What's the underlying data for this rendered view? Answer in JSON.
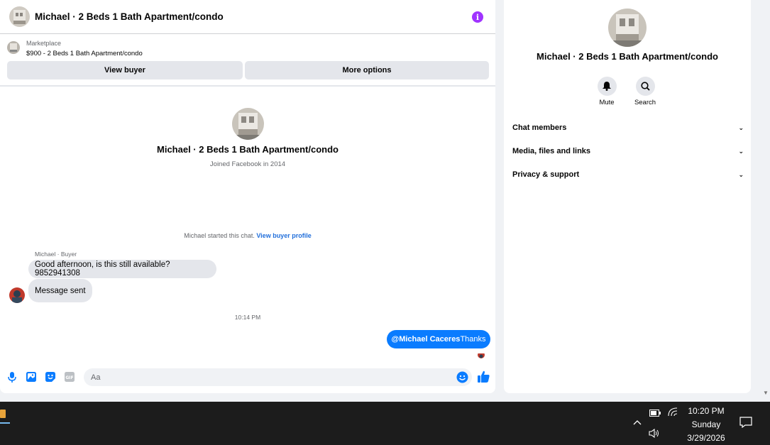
{
  "chat": {
    "title": "Michael · 2 Beds 1 Bath Apartment/condo",
    "info_icon": "info-icon"
  },
  "marketplace": {
    "label": "Marketplace",
    "item": "$900 - 2 Beds 1 Bath Apartment/condo",
    "view_buyer": "View buyer",
    "more_options": "More options"
  },
  "profile": {
    "name": "Michael · 2 Beds 1 Bath Apartment/condo",
    "joined": "Joined Facebook in 2014"
  },
  "thread": {
    "started_text": "Michael started this chat.",
    "started_link": "View buyer profile",
    "sender_label": "Michael · Buyer",
    "messages_in": [
      "Good afternoon, is this still available? 9852941308",
      "Message sent"
    ],
    "timestamp": "10:14 PM",
    "message_out_mention": "@Michael Caceres",
    "message_out_text": "Thanks"
  },
  "composer": {
    "placeholder": "Aa",
    "icons": [
      "microphone-icon",
      "photo-icon",
      "sticker-icon",
      "gif-icon",
      "emoji-icon",
      "like-icon"
    ]
  },
  "info_panel": {
    "name": "Michael · 2 Beds 1 Bath Apartment/condo",
    "actions": [
      {
        "label": "Mute",
        "icon": "bell-icon"
      },
      {
        "label": "Search",
        "icon": "search-icon"
      }
    ],
    "sections": [
      {
        "label": "Chat members"
      },
      {
        "label": "Media, files and links"
      },
      {
        "label": "Privacy & support"
      }
    ]
  },
  "taskbar": {
    "time": "10:20 PM",
    "day": "Sunday",
    "date": "3/29/2026"
  },
  "colors": {
    "accent": "#0a7cff",
    "info": "#a033ff",
    "link": "#216fdb",
    "bubble_in": "#e4e6eb",
    "taskbar": "#1c1c1c"
  }
}
